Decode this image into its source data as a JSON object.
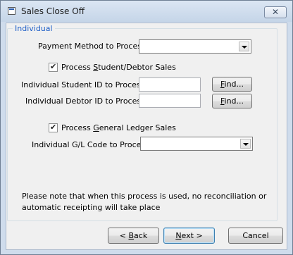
{
  "window": {
    "title": "Sales Close Off",
    "close_glyph": "✕"
  },
  "group": {
    "label": "Individual"
  },
  "payment_method": {
    "label": "Payment Method to Process:",
    "value": ""
  },
  "student_debtor": {
    "checkbox_label_pre": "Process ",
    "checkbox_label_u": "S",
    "checkbox_label_post": "tudent/Debtor Sales",
    "checked": true,
    "student_id_label": "Individual Student ID to  Process:",
    "student_id_value": "",
    "debtor_id_label": "Individual Debtor ID to  Process:",
    "debtor_id_value": "",
    "find_pre": "",
    "find_u": "F",
    "find_post": "ind..."
  },
  "general_ledger": {
    "checkbox_label_pre": "Process ",
    "checkbox_label_u": "G",
    "checkbox_label_post": "eneral Ledger Sales",
    "checked": true,
    "gl_code_label": "Individual G/L Code to Process:",
    "gl_code_value": ""
  },
  "note": {
    "line1": "Please note that when this process is used, no reconciliation or",
    "line2": "automatic receipting will take place"
  },
  "buttons": {
    "back_pre": "< ",
    "back_u": "B",
    "back_post": "ack",
    "next_u": "N",
    "next_post": "ext >",
    "cancel": "Cancel"
  }
}
